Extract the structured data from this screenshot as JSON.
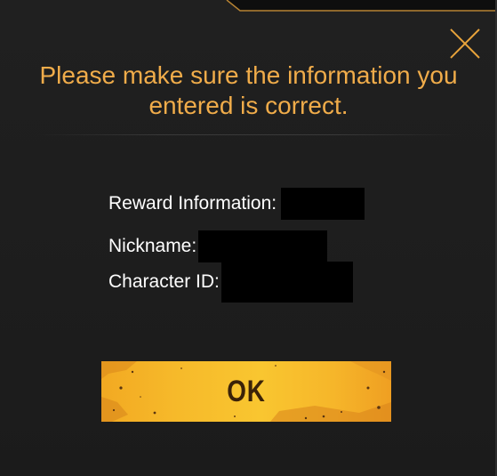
{
  "dialog": {
    "title": "Please make sure the information you entered is correct.",
    "close_icon": "close-icon",
    "fields": {
      "reward_label": "Reward Information:",
      "nickname_label": "Nickname:",
      "character_id_label": "Character ID:"
    },
    "ok_label": "OK"
  },
  "colors": {
    "background": "#1d1d1d",
    "title_text": "#f0ac4a",
    "accent_gold": "#e8a33b",
    "button_yellow": "#f9c630",
    "button_text": "#3b2208",
    "body_text": "#ffffff",
    "redaction": "#000000"
  }
}
